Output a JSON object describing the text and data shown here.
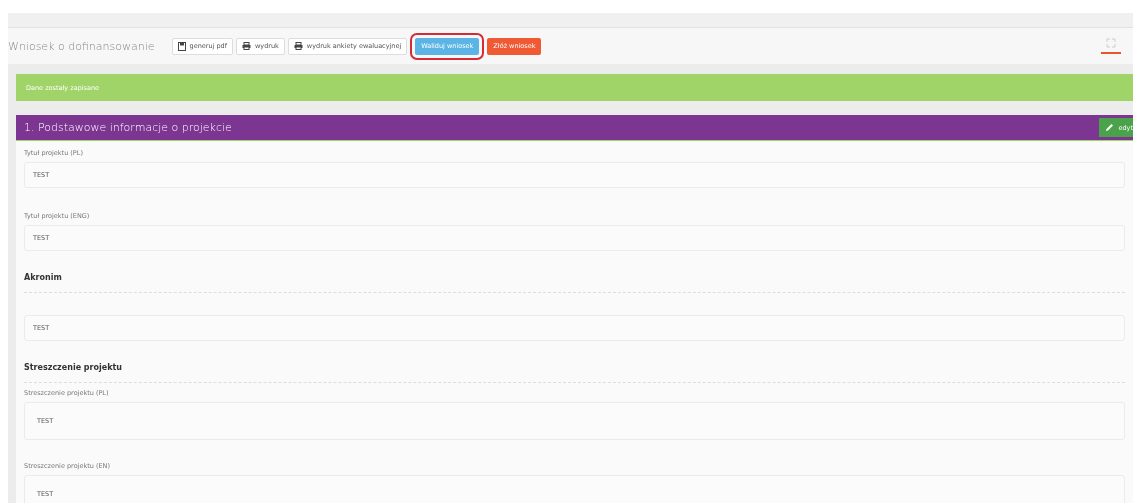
{
  "toolbar": {
    "title": "Wniosek o dofinansowanie",
    "buttons": [
      {
        "label": "generuj pdf",
        "kind": "file",
        "highlighted": false
      },
      {
        "label": "wydruk",
        "kind": "print",
        "highlighted": false
      },
      {
        "label": "wydruk ankiety ewaluacyjnej",
        "kind": "print",
        "highlighted": false
      },
      {
        "label": "Waliduj wniosek",
        "kind": "info",
        "highlighted": true
      },
      {
        "label": "Złóż wniosek",
        "kind": "danger",
        "highlighted": false
      }
    ]
  },
  "alert": {
    "text": "Dane zostały zapisane"
  },
  "section": {
    "title": "1. Podstawowe informacje o projekcie",
    "edit_button": "edyt",
    "items": [
      {
        "kind": "field",
        "label": "Tytuł projektu (PL)",
        "value": "TEST"
      },
      {
        "kind": "field",
        "label": "Tytuł projektu (ENG)",
        "value": "TEST"
      },
      {
        "kind": "heading",
        "label": "Akronim"
      },
      {
        "kind": "field",
        "value": "TEST"
      },
      {
        "kind": "heading",
        "label": "Streszczenie projektu"
      },
      {
        "kind": "textarea",
        "label": "Streszczenie projektu (PL)",
        "value": "TEST"
      },
      {
        "kind": "textarea",
        "label": "Streszczenie projektu (EN)",
        "value": "TEST"
      }
    ]
  }
}
